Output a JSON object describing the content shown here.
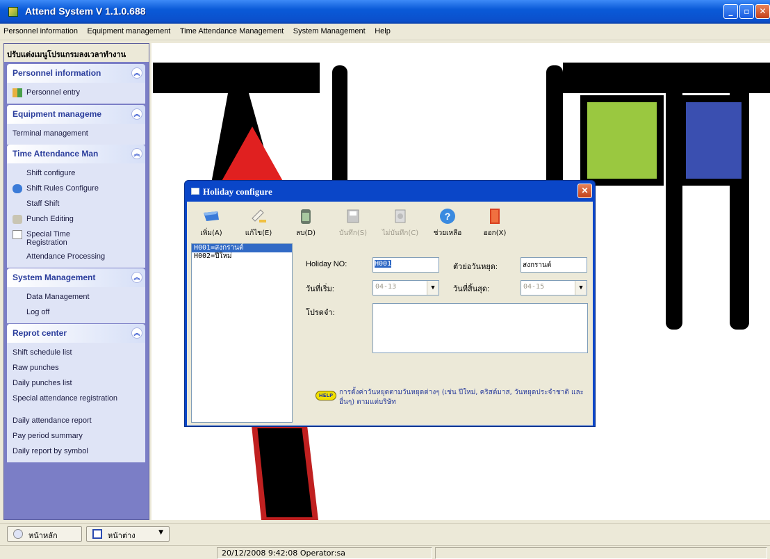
{
  "window": {
    "title": "Attend System V 1.1.0.688",
    "min": "_",
    "max": "▫",
    "close": "✕"
  },
  "menubar": [
    "Personnel information",
    "Equipment management",
    "Time Attendance Management",
    "System Management",
    "Help"
  ],
  "sidebar": {
    "header": "ปรับแต่งเมนูโปรแกรมลงเวลาทำงาน",
    "groups": [
      {
        "title": "Personnel information",
        "items": [
          "Personnel entry"
        ]
      },
      {
        "title": "Equipment manageme",
        "items": [
          "Terminal management"
        ]
      },
      {
        "title": "Time Attendance Man",
        "items": [
          "Shift configure",
          "Shift Rules Configure",
          "Staff Shift",
          "Punch Editing",
          "Special Time Registration",
          "Attendance Processing"
        ]
      },
      {
        "title": "System Management",
        "items": [
          "Data Management",
          "Log off"
        ]
      },
      {
        "title": "Reprot center",
        "items": [
          "Shift schedule list",
          "Raw punches",
          "Daily punches list",
          "Special attendance registration",
          "Daily attendance report",
          "Pay period summary",
          "Daily report by symbol"
        ]
      }
    ]
  },
  "taskbar": {
    "home": "หน้าหลัก",
    "window": "หน้าต่าง"
  },
  "statusbar": {
    "datetime": "20/12/2008 9:42:08",
    "operator": "Operator:sa"
  },
  "dialog": {
    "title": "Holiday configure",
    "toolbar": [
      {
        "label": "เพิ่ม(A)",
        "enabled": true
      },
      {
        "label": "แก้ไข(E)",
        "enabled": true
      },
      {
        "label": "ลบ(D)",
        "enabled": true
      },
      {
        "label": "บันทึก(S)",
        "enabled": false
      },
      {
        "label": "ไม่บันทึก(C)",
        "enabled": false
      },
      {
        "label": "ช่วยเหลือ",
        "enabled": true
      },
      {
        "label": "ออก(X)",
        "enabled": true
      }
    ],
    "list": [
      "H001=สงกรานต์",
      "H002=ปีใหม่"
    ],
    "form": {
      "holiday_no_label": "Holiday NO:",
      "holiday_no_value": "H001",
      "holiday_name_label": "ตัวย่อวันหยุด:",
      "holiday_name_value": "สงกรานต์",
      "start_label": "วันที่เริ่ม:",
      "start_value": "04-13",
      "end_label": "วันที่สิ้นสุด:",
      "end_value": "04-15",
      "remark_label": "โปรดจำ:"
    },
    "hint_icon": "HELP",
    "hint": "การตั้งค่าวันหยุดตามวันหยุดต่างๆ (เช่น ปีใหม่, คริสต์มาส, วันหยุดประจำชาติ และ อื่นๆ) ตามแต่บริษัท"
  }
}
